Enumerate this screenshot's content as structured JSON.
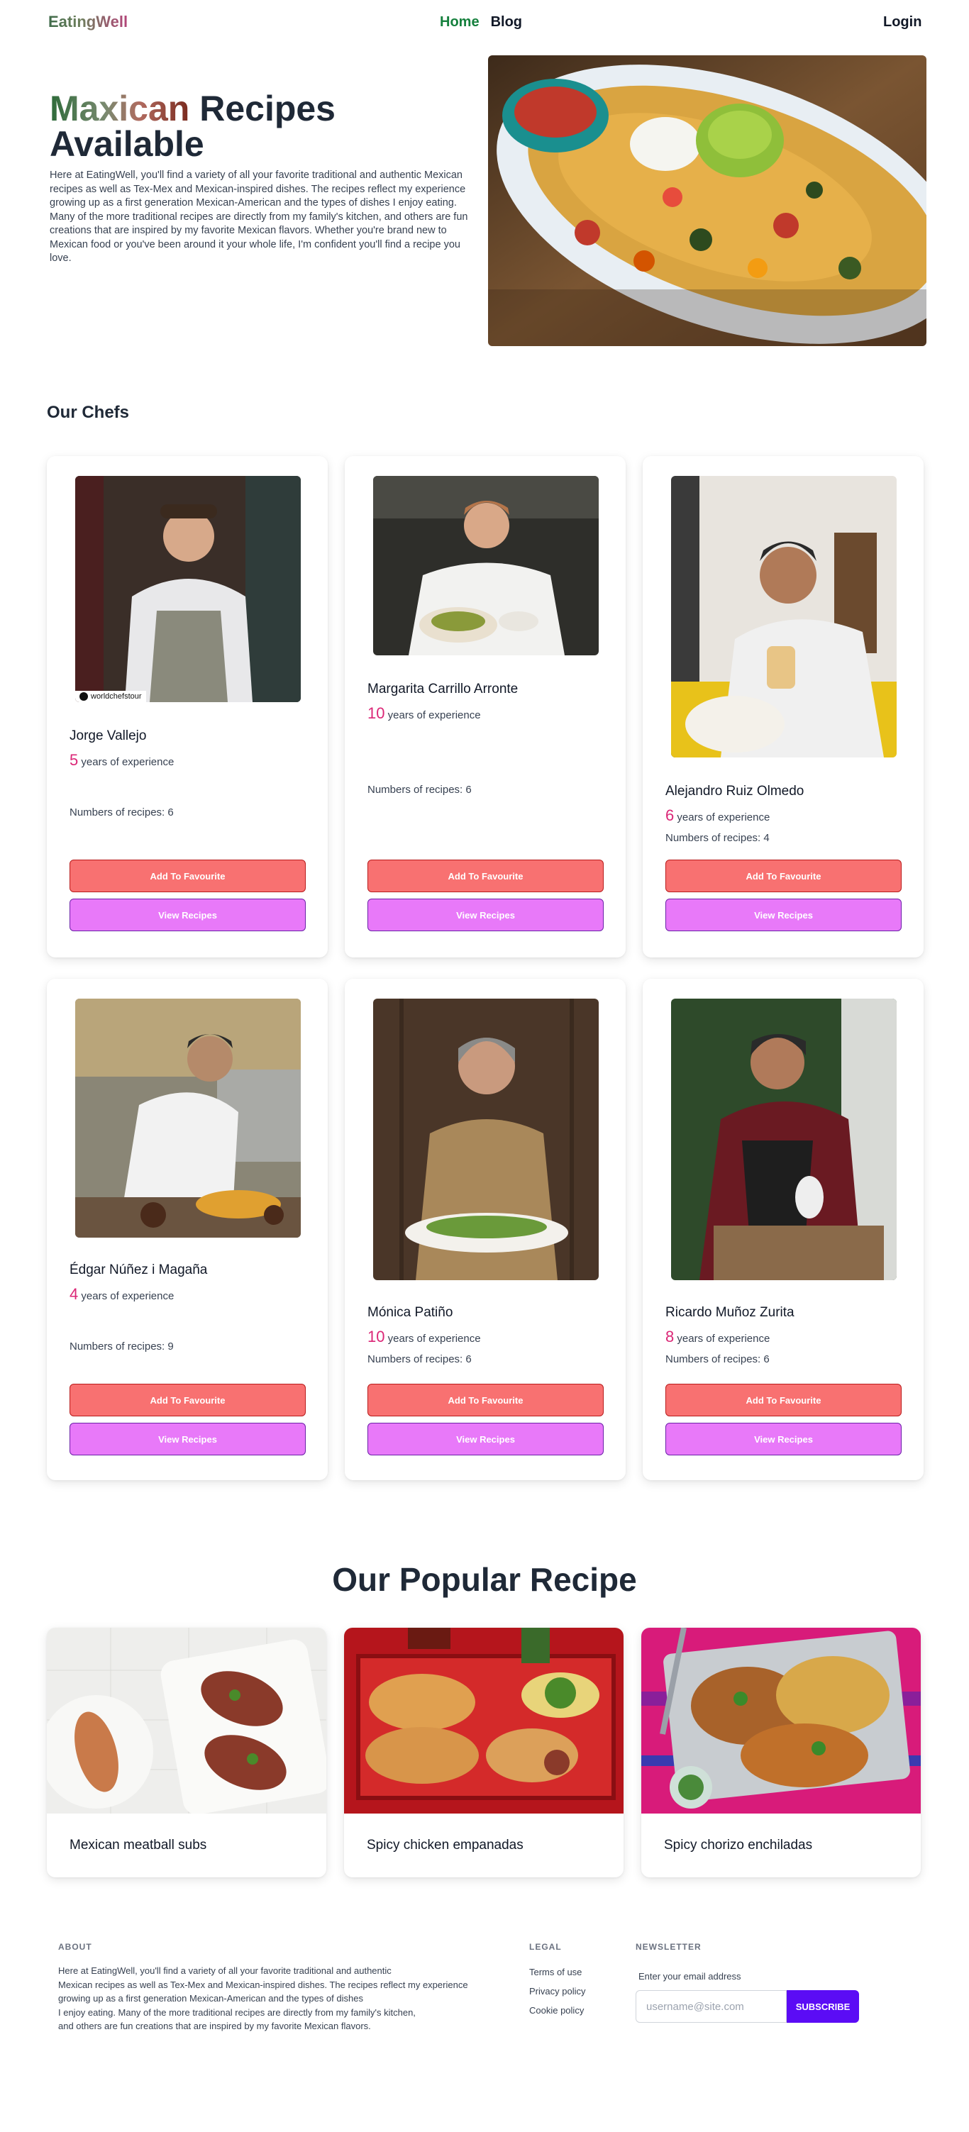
{
  "nav": {
    "logo": "EatingWell",
    "home": "Home",
    "blog": "Blog",
    "login": "Login"
  },
  "hero": {
    "title_grad": "Maxican",
    "title_rest": " Recipes Available",
    "description": "Here at EatingWell, you'll find a variety of all your favorite traditional and authentic Mexican recipes as well as Tex-Mex and Mexican-inspired dishes. The recipes reflect my experience growing up as a first generation Mexican-American and the types of dishes I enjoy eating. Many of the more traditional recipes are directly from my family's kitchen, and others are fun creations that are inspired by my favorite Mexican flavors. Whether you're brand new to Mexican food or you've been around it your whole life, I'm confident you'll find a recipe you love."
  },
  "chefs_title": "Our Chefs",
  "chef_labels": {
    "years": "years of experience",
    "recipes_prefix": "Numbers of recipes: ",
    "fav": "Add To Favourite",
    "view": "View Recipes"
  },
  "chefs": [
    {
      "name": "Jorge Vallejo",
      "years": "5",
      "recipes": "Numbers of recipes: 6",
      "badge": "worldchefstour"
    },
    {
      "name": "Margarita Carrillo Arronte",
      "years": "10",
      "recipes": "Numbers of recipes: 6"
    },
    {
      "name": "Alejandro Ruiz Olmedo",
      "years": "6",
      "recipes": "Numbers of recipes: 4"
    },
    {
      "name": "Édgar Núñez i Magaña",
      "years": "4",
      "recipes": "Numbers of recipes: 9"
    },
    {
      "name": "Mónica Patiño",
      "years": "10",
      "recipes": "Numbers of recipes: 6"
    },
    {
      "name": "Ricardo Muñoz Zurita",
      "years": "8",
      "recipes": "Numbers of recipes: 6"
    }
  ],
  "popular_title": "Our Popular Recipe",
  "recipes": [
    {
      "name": "Mexican meatball subs"
    },
    {
      "name": "Spicy chicken empanadas"
    },
    {
      "name": "Spicy chorizo enchiladas"
    }
  ],
  "footer": {
    "about_heading": "ABOUT",
    "about_lines": [
      "Here at EatingWell, you'll find a variety of all your favorite traditional and authentic",
      "Mexican recipes as well as Tex-Mex and Mexican-inspired dishes. The recipes reflect my experience",
      "growing up as a first generation Mexican-American and the types of dishes",
      "I enjoy eating. Many of the more traditional recipes are directly from my family's kitchen,",
      "and others are fun creations that are inspired by my favorite Mexican flavors."
    ],
    "legal_heading": "LEGAL",
    "legal_links": [
      "Terms of use",
      "Privacy policy",
      "Cookie policy"
    ],
    "newsletter_heading": "NEWSLETTER",
    "email_label": "Enter your email address",
    "email_placeholder": "username@site.com",
    "subscribe": "SUBSCRIBE"
  },
  "colors": {
    "accent_green": "#15803d",
    "exp_pink": "#db2777",
    "fav_red": "#f87171",
    "view_purple": "#e879f9",
    "subscribe": "#5b0cf5"
  }
}
